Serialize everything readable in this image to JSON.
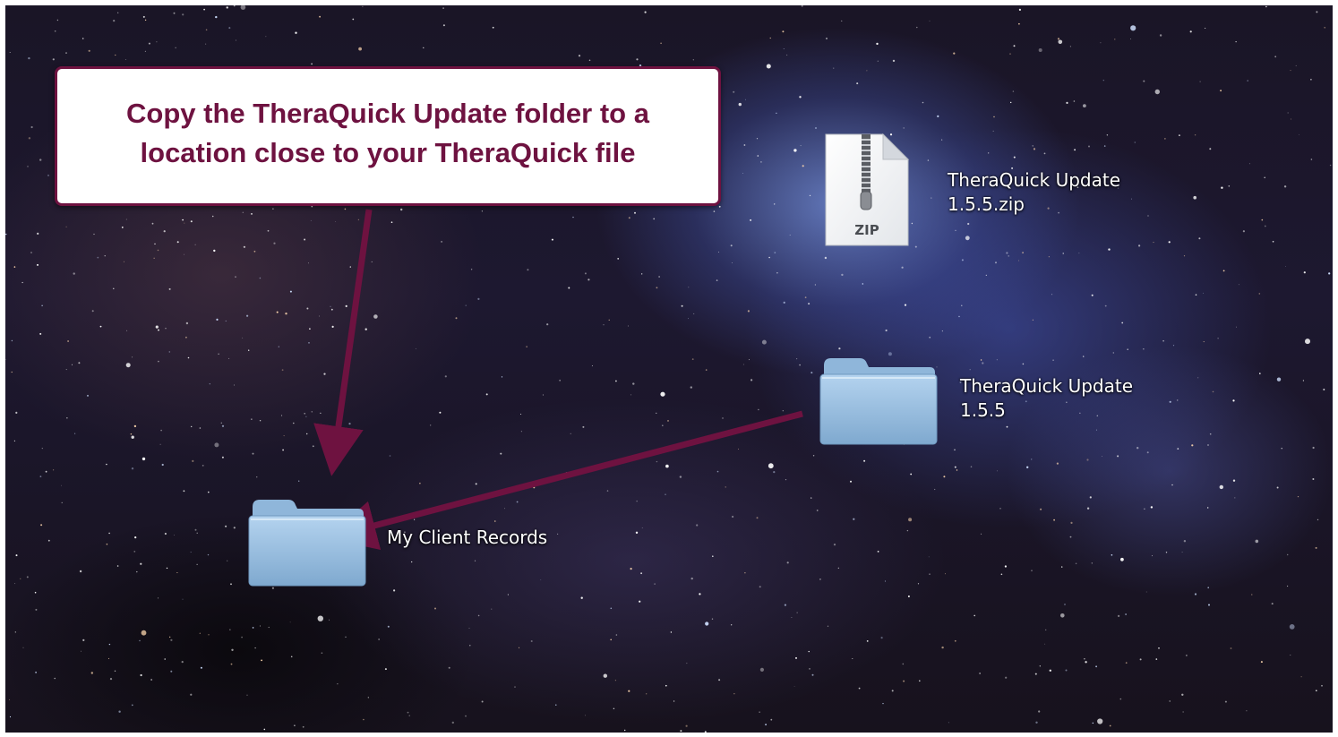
{
  "callout": {
    "text": "Copy the TheraQuick Update folder to a location close to your TheraQuick file"
  },
  "desktop": {
    "icons": [
      {
        "kind": "zip-file",
        "label_line1": "TheraQuick Update",
        "label_line2": "1.5.5.zip",
        "badge": "ZIP"
      },
      {
        "kind": "folder",
        "label_line1": "TheraQuick Update",
        "label_line2": "1.5.5"
      },
      {
        "kind": "folder",
        "label_line1": "My Client Records",
        "label_line2": ""
      }
    ]
  },
  "colors": {
    "callout_accent": "#6e1240",
    "arrow": "#6e1240",
    "folder_blue": "#9cc3e6"
  }
}
